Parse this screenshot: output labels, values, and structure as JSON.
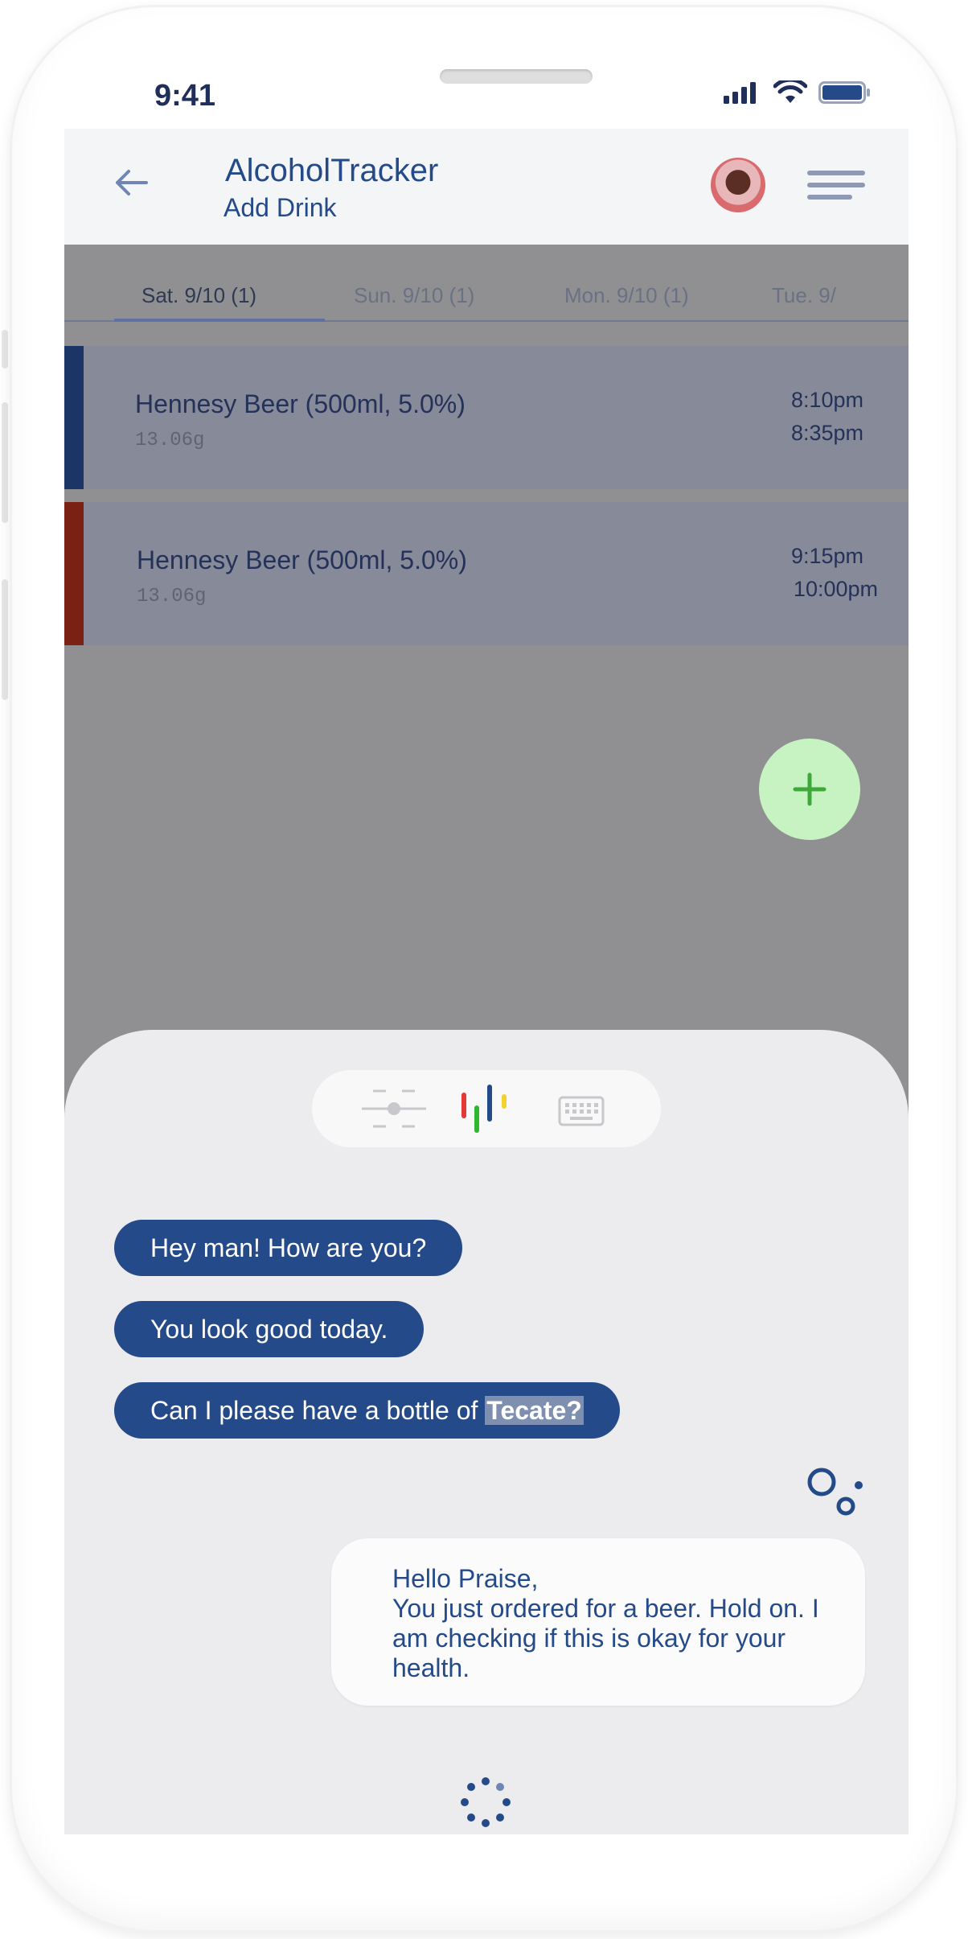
{
  "status_bar": {
    "time": "9:41",
    "icons": [
      "signal-icon",
      "wifi-icon",
      "battery-icon"
    ]
  },
  "header": {
    "title": "AlcoholTracker",
    "subtitle": "Add Drink",
    "back_icon": "arrow-left-icon",
    "menu_icon": "hamburger-menu-icon"
  },
  "tabs": [
    {
      "label": "Sat. 9/10 (1)",
      "active": true
    },
    {
      "label": "Sun. 9/10 (1)",
      "active": false
    },
    {
      "label": "Mon. 9/10 (1)",
      "active": false
    },
    {
      "label": "Tue. 9/",
      "active": false
    }
  ],
  "drinks": [
    {
      "name": "Hennesy Beer (500ml, 5.0%)",
      "grams": "13.06g",
      "start": "8:10pm",
      "end": "8:35pm",
      "color": "#1b3566"
    },
    {
      "name": "Hennesy Beer (500ml, 5.0%)",
      "grams": "13.06g",
      "start": "9:15pm",
      "end": "10:00pm",
      "color": "#7a2113"
    }
  ],
  "fab": {
    "icon": "plus-icon",
    "color": "#3fa83a"
  },
  "assistant": {
    "modes": [
      "lens-icon",
      "voice-bars-icon",
      "keyboard-icon"
    ],
    "user_messages": [
      {
        "text": "Hey man! How are you?"
      },
      {
        "text": "You look good today."
      },
      {
        "text_before": "Can I please have a bottle of ",
        "highlight": "Tecate?"
      }
    ],
    "reply_lines": [
      "Hello Praise,",
      "You just ordered for a beer. Hold on. I",
      "am checking if this is okay for your",
      "health."
    ],
    "assistant_icon": "google-assistant-icon",
    "loading_icon": "loading-dots-icon"
  },
  "colors": {
    "primary": "#244a8a",
    "fab_bg": "#c7f3c2",
    "voice_red": "#e53935",
    "voice_green": "#2eb82e",
    "voice_blue": "#244a8a",
    "voice_yellow": "#f2d22e"
  }
}
